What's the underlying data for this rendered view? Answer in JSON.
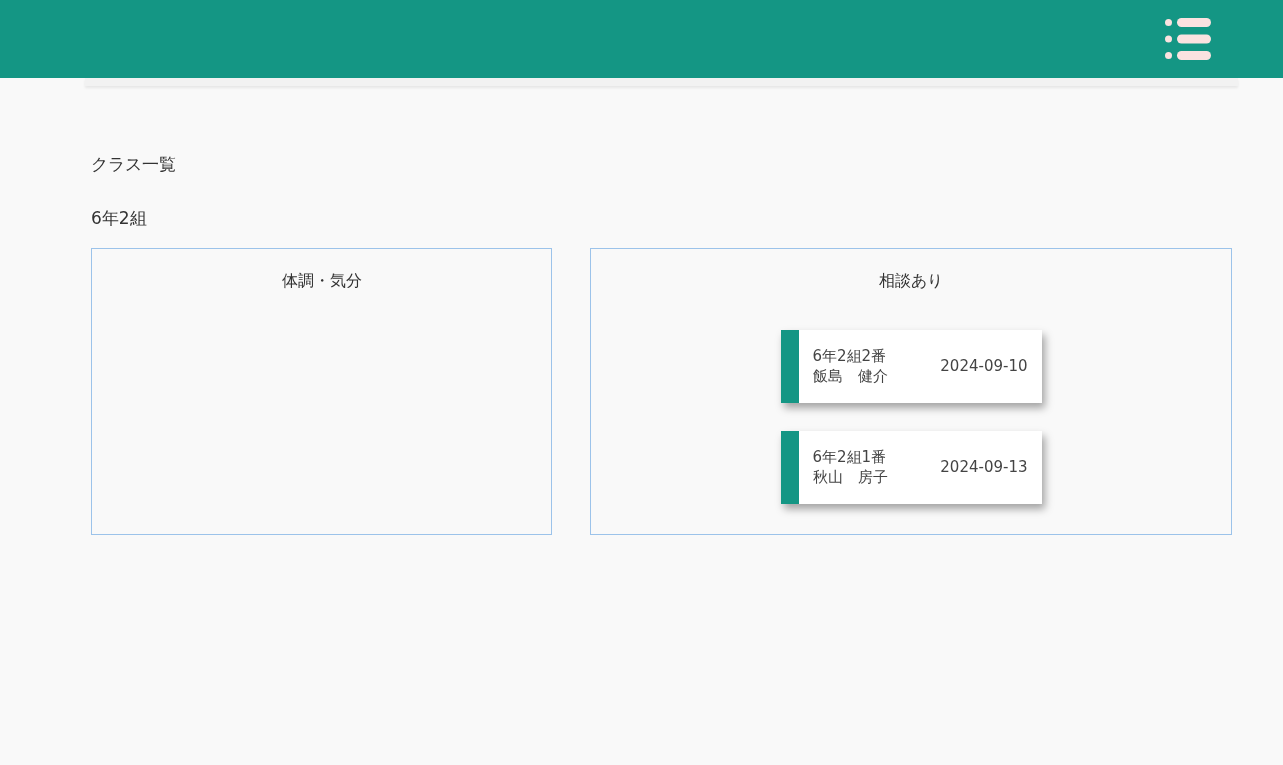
{
  "page_title": "クラス一覧",
  "class_name": "6年2組",
  "panels": [
    {
      "title": "体調・気分"
    },
    {
      "title": "相談あり",
      "entries": [
        {
          "student": "6年2組2番",
          "name": "飯島　健介",
          "date": "2024-09-10"
        },
        {
          "student": "6年2組1番",
          "name": "秋山　房子",
          "date": "2024-09-13"
        }
      ]
    }
  ]
}
